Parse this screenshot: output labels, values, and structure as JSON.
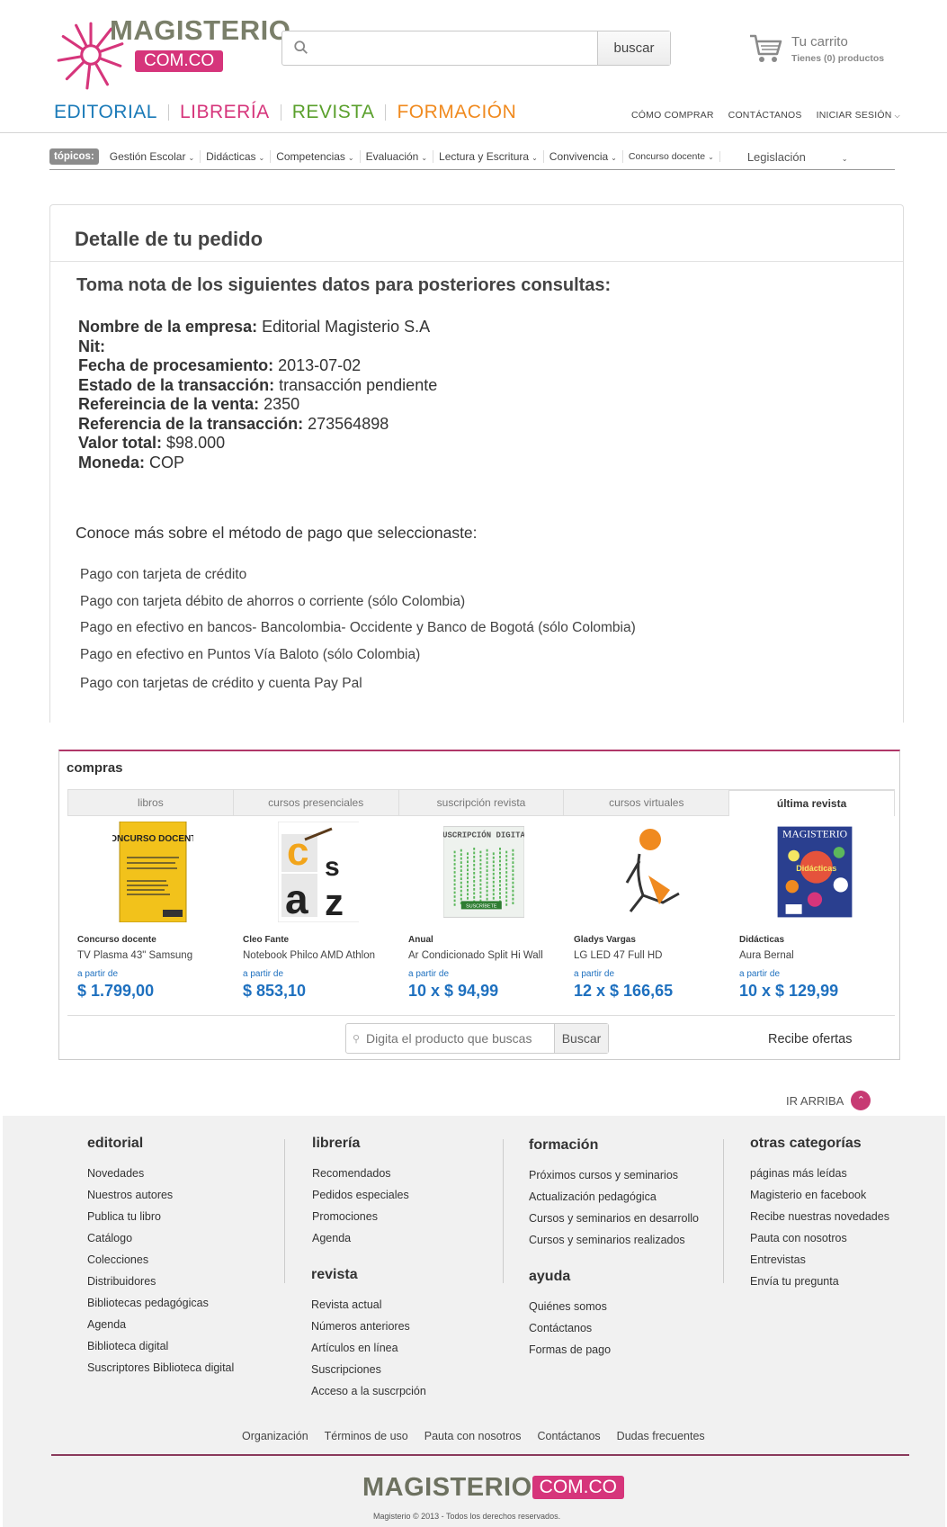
{
  "header": {
    "logo_word": "MAGISTERIO",
    "logo_domain": "COM.CO",
    "search_placeholder": "",
    "search_button": "buscar",
    "cart_title": "Tu carrito",
    "cart_subtitle": "Tienes (0) productos"
  },
  "main_nav": [
    {
      "label": "EDITORIAL",
      "color": "#1a7ab8"
    },
    {
      "label": "LIBRERÍA",
      "color": "#d6357b"
    },
    {
      "label": "REVISTA",
      "color": "#5aa02c"
    },
    {
      "label": "FORMACIÓN",
      "color": "#f08a1f"
    }
  ],
  "util_nav": [
    "CÓMO COMPRAR",
    "CONTÁCTANOS",
    "INICIAR SESIÓN"
  ],
  "topics": {
    "label": "tópicos:",
    "items": [
      "Gestión Escolar",
      "Didácticas",
      "Competencias",
      "Evaluación",
      "Lectura y Escritura",
      "Convivencia",
      "Concurso docente",
      "Legislación"
    ]
  },
  "order": {
    "title": "Detalle de tu pedido",
    "note": "Toma nota de los siguientes datos para posteriores consultas:",
    "fields": [
      {
        "label": "Nombre de la empresa:",
        "value": "Editorial Magisterio S.A"
      },
      {
        "label": "Nit:",
        "value": ""
      },
      {
        "label": "Fecha de procesamiento:",
        "value": "2013-07-02"
      },
      {
        "label": "Estado de la transacción:",
        "value": "transacción pendiente"
      },
      {
        "label": "Refereincia de la venta:",
        "value": "2350"
      },
      {
        "label": "Referencia de la transacción:",
        "value": "273564898"
      },
      {
        "label": "Valor total:",
        "value": "$98.000"
      },
      {
        "label": "Moneda:",
        "value": "COP"
      }
    ],
    "payment_title": "Conoce más sobre el método de pago que seleccionaste:",
    "payment_methods": [
      "Pago con tarjeta de crédito",
      "Pago con tarjeta débito de ahorros o corriente (sólo Colombia)",
      "Pago en efectivo en bancos- Bancolombia- Occidente y Banco de Bogotá (sólo Colombia)",
      "Pago en efectivo en Puntos Vía Baloto (sólo Colombia)",
      "Pago con tarjetas de crédito y cuenta Pay Pal"
    ]
  },
  "compras": {
    "title": "compras",
    "tabs": [
      "libros",
      "cursos presenciales",
      "suscripción revista",
      "cursos virtuales",
      "última revista"
    ],
    "products": [
      {
        "category": "Concurso docente",
        "name": "TV Plasma 43\" Samsung",
        "from": "a partir de",
        "price": "$ 1.799,00",
        "icon": "concurso-docente-book"
      },
      {
        "category": "Cleo Fante",
        "name": "Notebook Philco AMD Athlon",
        "from": "a partir de",
        "price": "$ 853,10",
        "icon": "letters-book"
      },
      {
        "category": "Anual",
        "name": "Ar Condicionado Split Hi Wall",
        "from": "a partir de",
        "price": "10 x $ 94,99",
        "icon": "suscripcion-digital"
      },
      {
        "category": "Gladys Vargas",
        "name": "LG LED 47 Full HD",
        "from": "a partir de",
        "price": "12 x $ 166,65",
        "icon": "virtual-course-figure"
      },
      {
        "category": "Didácticas",
        "name": "Aura Bernal",
        "from": "a partir de",
        "price": "10 x $ 129,99",
        "icon": "magazine-cover"
      }
    ],
    "search_placeholder": "Digita el producto que buscas",
    "search_button": "Buscar",
    "offers": "Recibe ofertas",
    "magazine_word": "MAGISTERIO",
    "magazine_sub": "Didácticas",
    "concurso_word": "CONCURSO DOCENTE",
    "suscripcion_word": "SUSCRIPCIÓN DIGITAL",
    "suscribete": "SUSCRÍBETE"
  },
  "go_top": "IR ARRIBA",
  "footer": {
    "editorial": {
      "title": "editorial",
      "links": [
        "Novedades",
        "Nuestros autores",
        "Publica tu libro",
        "Catálogo",
        "Colecciones",
        "Distribuidores",
        "Bibliotecas pedagógicas",
        "Agenda",
        "Biblioteca digital",
        "Suscriptores Biblioteca digital"
      ]
    },
    "libreria": {
      "title": "librería",
      "links": [
        "Recomendados",
        "Pedidos especiales",
        "Promociones",
        "Agenda"
      ]
    },
    "revista": {
      "title": "revista",
      "links": [
        "Revista actual",
        "Números anteriores",
        "Artículos en línea",
        "Suscripciones",
        "Acceso a la suscrpción"
      ]
    },
    "formacion": {
      "title": "formación",
      "links": [
        "Próximos cursos y seminarios",
        "Actualización pedagógica",
        "Cursos y seminarios en desarrollo",
        "Cursos y seminarios realizados"
      ]
    },
    "ayuda": {
      "title": "ayuda",
      "links": [
        "Quiénes somos",
        "Contáctanos",
        "Formas de pago"
      ]
    },
    "otras": {
      "title": "otras categorías",
      "links": [
        "páginas más leídas",
        "Magisterio en facebook",
        "Recibe nuestras novedades",
        "Pauta con nosotros",
        "Entrevistas",
        "Envía tu pregunta"
      ]
    },
    "bottom_links": [
      "Organización",
      "Términos de uso",
      "Pauta con nosotros",
      "Contáctanos",
      "Dudas frecuentes"
    ],
    "logo_word": "MAGISTERIO",
    "logo_domain": "COM.CO",
    "copyright": "Magisterio © 2013 - Todos los derechos reservados."
  }
}
